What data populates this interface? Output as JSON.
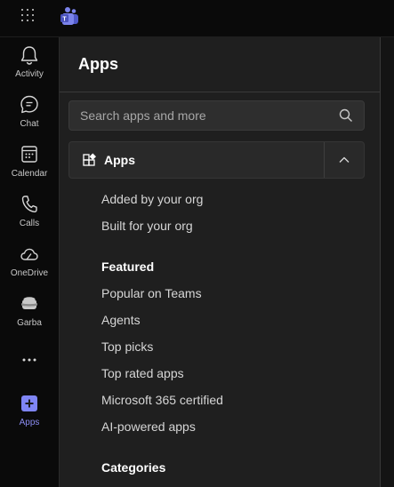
{
  "rail": {
    "items": [
      {
        "label": "Activity",
        "icon": "bell-icon"
      },
      {
        "label": "Chat",
        "icon": "chat-icon"
      },
      {
        "label": "Calendar",
        "icon": "calendar-icon"
      },
      {
        "label": "Calls",
        "icon": "phone-icon"
      },
      {
        "label": "OneDrive",
        "icon": "cloud-icon"
      },
      {
        "label": "Garba",
        "icon": "app-icon"
      },
      {
        "label": "Apps",
        "icon": "plus-square-icon"
      }
    ],
    "more_icon": "ellipsis-icon"
  },
  "panel": {
    "title": "Apps",
    "search_placeholder": "Search apps and more",
    "section_label": "Apps",
    "nav": {
      "top_items": [
        "Added by your org",
        "Built for your org"
      ],
      "featured_title": "Featured",
      "featured_items": [
        "Popular on Teams",
        "Agents",
        "Top picks",
        "Top rated apps",
        "Microsoft 365 certified",
        "AI-powered apps"
      ],
      "categories_title": "Categories"
    }
  },
  "colors": {
    "accent": "#7f85f5",
    "background": "#0a0a0a",
    "panel": "#1f1f1f"
  }
}
